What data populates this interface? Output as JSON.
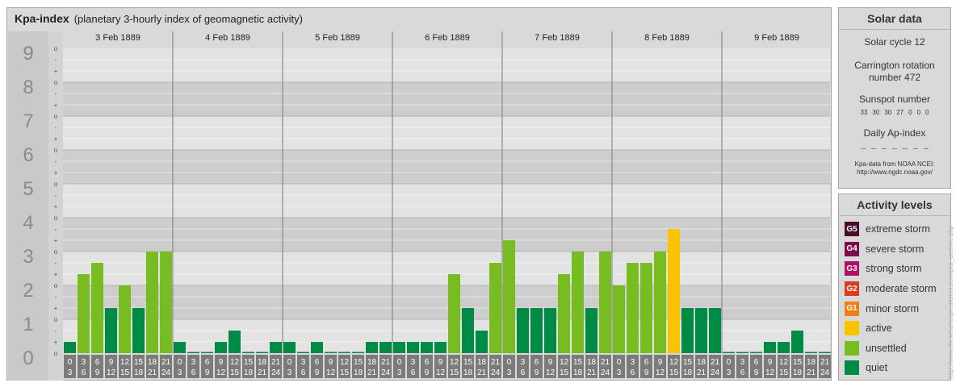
{
  "header": {
    "title": "Kpa-index",
    "subtitle": "(planetary 3-hourly index of geomagnetic activity)"
  },
  "chart_data": {
    "type": "bar",
    "ylim": [
      0,
      9
    ],
    "y_major_ticks": [
      "0",
      "1",
      "2",
      "3",
      "4",
      "5",
      "6",
      "7",
      "8",
      "9"
    ],
    "y_minor_ticks": [
      "+",
      "o",
      "-"
    ],
    "days": [
      "3 Feb 1889",
      "4 Feb 1889",
      "5 Feb 1889",
      "6 Feb 1889",
      "7 Feb 1889",
      "8 Feb 1889",
      "9 Feb 1889"
    ],
    "interval_start": [
      "0",
      "3",
      "6",
      "9",
      "12",
      "15",
      "18",
      "21"
    ],
    "interval_end": [
      "3",
      "6",
      "9",
      "12",
      "15",
      "18",
      "21",
      "24"
    ],
    "values": [
      [
        0.333,
        2.333,
        2.667,
        1.333,
        2.0,
        1.333,
        3.0,
        3.0
      ],
      [
        0.333,
        0.0,
        0.0,
        0.333,
        0.667,
        0.0,
        0.0,
        0.333
      ],
      [
        0.333,
        0.0,
        0.333,
        0.0,
        0.0,
        0.0,
        0.333,
        0.333
      ],
      [
        0.333,
        0.333,
        0.333,
        0.333,
        2.333,
        1.333,
        0.667,
        2.667
      ],
      [
        3.333,
        1.333,
        1.333,
        1.333,
        2.333,
        3.0,
        1.333,
        3.0
      ],
      [
        2.0,
        2.667,
        2.667,
        3.0,
        3.667,
        1.333,
        1.333,
        1.333
      ],
      [
        0.0,
        0.0,
        0.0,
        0.333,
        0.333,
        0.667,
        0.0,
        0.0
      ]
    ],
    "level_colors": {
      "quiet": "#008b45",
      "unsettled": "#77bd22",
      "active": "#f9c300"
    }
  },
  "solar": {
    "title": "Solar data",
    "cycle": "Solar cycle 12",
    "carrington_1": "Carrington rotation",
    "carrington_2": "number 472",
    "sunspot_title": "Sunspot number",
    "sunspot_values": [
      "33",
      "30",
      "30",
      "27",
      "0",
      "0",
      "0"
    ],
    "ap_title": "Daily Ap-index",
    "ap_values": [
      "--",
      "--",
      "--",
      "--",
      "--",
      "--",
      "--"
    ],
    "source_1": "Kpa-data from NOAA NCEI:",
    "source_2": "http://www.ngdc.noaa.gov/"
  },
  "activity": {
    "title": "Activity levels",
    "levels": [
      {
        "code": "G5",
        "label": "extreme storm",
        "color": "#4a0c2b"
      },
      {
        "code": "G4",
        "label": "severe storm",
        "color": "#7d0c48"
      },
      {
        "code": "G3",
        "label": "strong storm",
        "color": "#b01065"
      },
      {
        "code": "G2",
        "label": "moderate storm",
        "color": "#d93d1e"
      },
      {
        "code": "G1",
        "label": "minor storm",
        "color": "#ef7f13"
      },
      {
        "code": "",
        "label": "active",
        "color": "#f9c300"
      },
      {
        "code": "",
        "label": "unsettled",
        "color": "#77bd22"
      },
      {
        "code": "",
        "label": "quiet",
        "color": "#008b45"
      }
    ]
  },
  "watermark": "http://www.theweatherprediction.com/pro_archive.php"
}
